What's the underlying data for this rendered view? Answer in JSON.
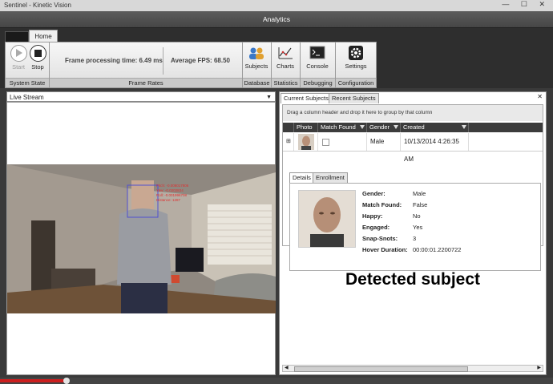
{
  "window": {
    "title": "Sentinel - Kinetic Vision",
    "controls": "— ☐ ✕"
  },
  "header": {
    "title": "Analytics"
  },
  "ribbon": {
    "tab_home": "Home",
    "system_state": {
      "start": "Start",
      "stop": "Stop",
      "label": "System State"
    },
    "frame_rates": {
      "processing": "Frame processing time: 6.49 ms",
      "fps": "Average FPS: 68.50",
      "label": "Frame Rates"
    },
    "database": {
      "subjects": "Subjects",
      "label": "Database"
    },
    "statistics": {
      "charts": "Charts",
      "label": "Statistics"
    },
    "debugging": {
      "console": "Console",
      "label": "Debugging"
    },
    "configuration": {
      "settings": "Settings",
      "label": "Configuration"
    }
  },
  "left": {
    "stream_select": "Live Stream",
    "overlay": [
      "Pitch: -0.008017806",
      "Yaw: -0.0202834",
      "Roll: -0.001996708",
      "Distance: 1287"
    ]
  },
  "right": {
    "tabs": [
      "Current Subjects",
      "Recent Subjects"
    ],
    "close": "✕",
    "group_hint": "Drag a column header and drop it here to group by that column",
    "columns": [
      "Photo",
      "Match Found",
      "Gender",
      "Created"
    ],
    "row": {
      "expand": "⊞",
      "gender": "Male",
      "created": "10/13/2014 4:26:35 AM"
    },
    "detail_tabs": [
      "Details",
      "Enrollment"
    ],
    "details": [
      {
        "label": "Gender:",
        "value": "Male"
      },
      {
        "label": "Match Found:",
        "value": "False"
      },
      {
        "label": "Happy:",
        "value": "No"
      },
      {
        "label": "Engaged:",
        "value": "Yes"
      },
      {
        "label": "Snap-Snots:",
        "value": "3"
      },
      {
        "label": "Hover Duration:",
        "value": "00:00:01.2200722"
      }
    ],
    "caption": "Detected subject"
  },
  "playback": {
    "progress": 0.12
  },
  "colors": {
    "accent_red": "#cc1f1f",
    "header_bg": "#464646"
  }
}
